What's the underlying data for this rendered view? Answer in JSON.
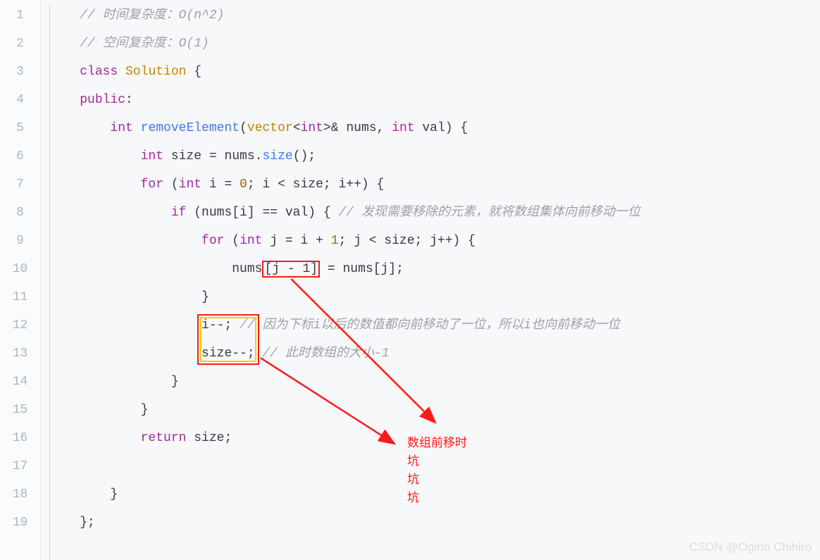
{
  "gutter": [
    "1",
    "2",
    "3",
    "4",
    "5",
    "6",
    "7",
    "8",
    "9",
    "10",
    "11",
    "12",
    "13",
    "14",
    "15",
    "16",
    "17",
    "18",
    "19"
  ],
  "code": {
    "l1_cm": "// 时间复杂度：O(n^2)",
    "l2_cm": "// 空间复杂度：O(1)",
    "l3_class": "class",
    "l3_name": "Solution",
    "l3_brace": " {",
    "l4_public": "public",
    "l4_colon": ":",
    "l5_int": "int",
    "l5_fn": "removeElement",
    "l5_open": "(",
    "l5_vector": "vector",
    "l5_lt": "<",
    "l5_int2": "int",
    "l5_gt": ">",
    "l5_rest": "& nums, ",
    "l5_int3": "int",
    "l5_rest2": " val) {",
    "l6_int": "int",
    "l6_rest": " size = nums.",
    "l6_size": "size",
    "l6_rest2": "();",
    "l7_for": "for",
    "l7_open": " (",
    "l7_int": "int",
    "l7_rest": " i = ",
    "l7_zero": "0",
    "l7_rest2": "; i < size; i++) {",
    "l8_if": "if",
    "l8_rest": " (nums[i] == val) { ",
    "l8_cm": "// 发现需要移除的元素，就将数组集体向前移动一位",
    "l9_for": "for",
    "l9_open": " (",
    "l9_int": "int",
    "l9_rest": " j = i + ",
    "l9_one": "1",
    "l9_rest2": "; j < size; j++) {",
    "l10_pre": "nums",
    "l10_box": "[j - 1]",
    "l10_post": " = nums[j];",
    "l11_brace": "}",
    "l12_code": "i--;",
    "l12_cm": " // 因为下标i以后的数值都向前移动了一位，所以i也向前移动一位",
    "l13_code": "size--;",
    "l13_cm": " // 此时数组的大小-1",
    "l14_brace": "}",
    "l15_brace": "}",
    "l16_return": "return",
    "l16_rest": " size;",
    "l17": "",
    "l18_brace": "}",
    "l19_brace": "};"
  },
  "annotation": {
    "line1": "数组前移时",
    "line2": "坑",
    "line3": "坑",
    "line4": "坑"
  },
  "watermark": "CSDN @Ogino Chihiro"
}
